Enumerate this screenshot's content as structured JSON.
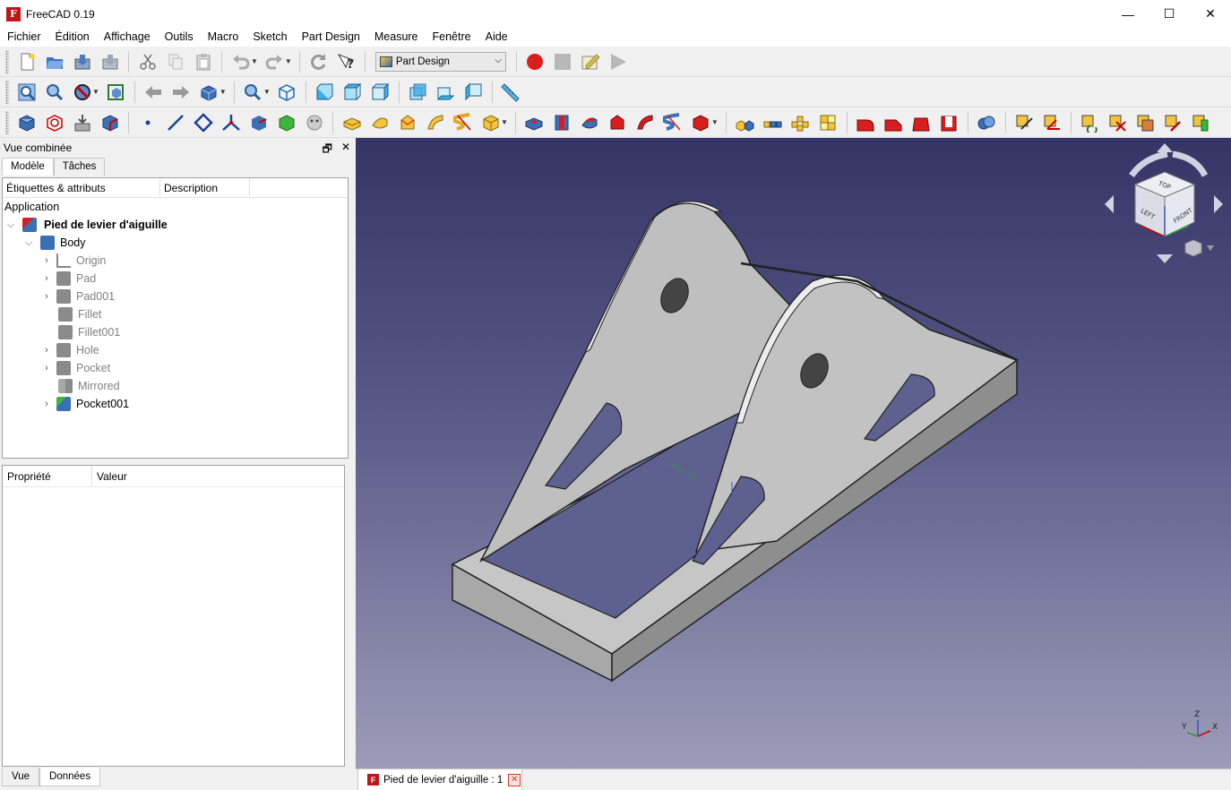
{
  "window": {
    "title": "FreeCAD 0.19",
    "minimize": "—",
    "maximize": "☐",
    "close": "✕"
  },
  "menu": [
    "Fichier",
    "Édition",
    "Affichage",
    "Outils",
    "Macro",
    "Sketch",
    "Part Design",
    "Measure",
    "Fenêtre",
    "Aide"
  ],
  "toolbar": {
    "workbench": "Part Design"
  },
  "combo": {
    "title": "Vue combinée",
    "float_btn": "🗗",
    "close_btn": "✕",
    "tabs": [
      "Modèle",
      "Tâches"
    ],
    "tree_headers": [
      "Étiquettes & attributs",
      "Description"
    ],
    "root_label": "Application",
    "document": "Pied de levier d'aiguille",
    "body": "Body",
    "features": [
      {
        "label": "Origin",
        "icon": "origin-icon"
      },
      {
        "label": "Pad",
        "icon": "pad-icon"
      },
      {
        "label": "Pad001",
        "icon": "pad-icon"
      },
      {
        "label": "Fillet",
        "icon": "fillet-icon"
      },
      {
        "label": "Fillet001",
        "icon": "fillet-icon"
      },
      {
        "label": "Hole",
        "icon": "hole-icon"
      },
      {
        "label": "Pocket",
        "icon": "pocket-icon"
      },
      {
        "label": "Mirrored",
        "icon": "mirrored-icon"
      },
      {
        "label": "Pocket001",
        "icon": "pocket-icon"
      }
    ],
    "prop_headers": [
      "Propriété",
      "Valeur"
    ],
    "bottom_tabs": [
      "Vue",
      "Données"
    ]
  },
  "navcube": {
    "top": "TOP",
    "front": "LEFT",
    "right": "FRONT"
  },
  "axis_labels": {
    "x": "X",
    "y": "Y",
    "z": "Z"
  },
  "doc_tab": {
    "label": "Pied de levier d'aiguille : 1",
    "logo": "F",
    "close": "✕"
  },
  "colors": {
    "accent": "#c0161b",
    "model": "#c8c8c8",
    "bg_top": "#343466",
    "bg_bottom": "#9c9cb8"
  }
}
